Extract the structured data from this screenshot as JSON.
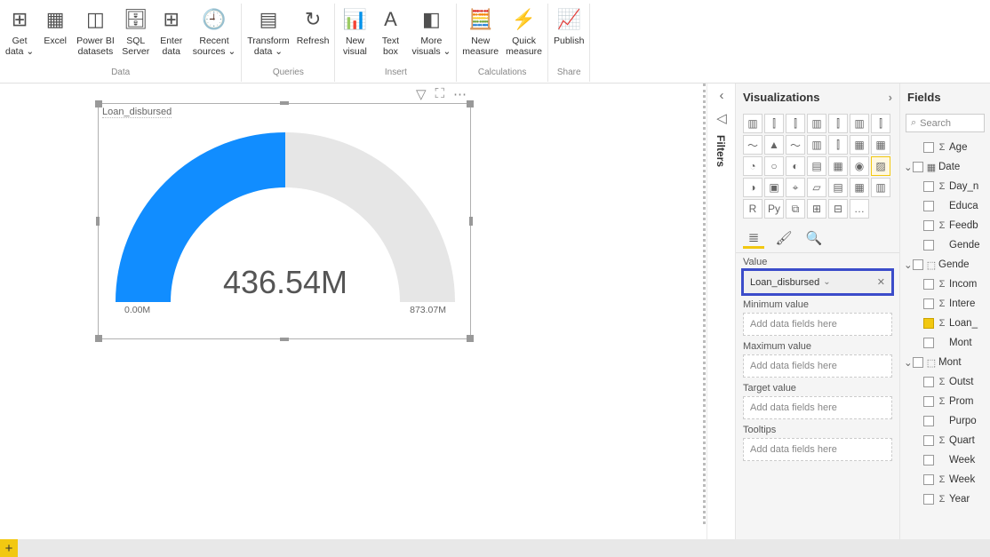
{
  "ribbon": {
    "groups": [
      {
        "label": "Data",
        "buttons": [
          {
            "label": "Get\ndata ⌄",
            "icon": "⊞"
          },
          {
            "label": "Excel",
            "icon": "▦"
          },
          {
            "label": "Power BI\ndatasets",
            "icon": "◫"
          },
          {
            "label": "SQL\nServer",
            "icon": "🗄"
          },
          {
            "label": "Enter\ndata",
            "icon": "⊞"
          },
          {
            "label": "Recent\nsources ⌄",
            "icon": "🕘"
          }
        ]
      },
      {
        "label": "Queries",
        "buttons": [
          {
            "label": "Transform\ndata ⌄",
            "icon": "▤"
          },
          {
            "label": "Refresh",
            "icon": "↻"
          }
        ]
      },
      {
        "label": "Insert",
        "buttons": [
          {
            "label": "New\nvisual",
            "icon": "📊"
          },
          {
            "label": "Text\nbox",
            "icon": "A"
          },
          {
            "label": "More\nvisuals ⌄",
            "icon": "◧"
          }
        ]
      },
      {
        "label": "Calculations",
        "buttons": [
          {
            "label": "New\nmeasure",
            "icon": "🧮"
          },
          {
            "label": "Quick\nmeasure",
            "icon": "⚡"
          }
        ]
      },
      {
        "label": "Share",
        "buttons": [
          {
            "label": "Publish",
            "icon": "📈"
          }
        ]
      }
    ]
  },
  "visual": {
    "title": "Loan_disbursed",
    "value_display": "436.54M",
    "min_label": "0.00M",
    "max_label": "873.07M",
    "actions": {
      "filter": "▽",
      "focus": "⛶",
      "more": "⋯"
    }
  },
  "collapsed": {
    "filters": "Filters",
    "arrow": "‹"
  },
  "viz": {
    "title": "Visualizations",
    "arrow": "›",
    "tabs": {
      "fields": "≣",
      "format": "🖌",
      "analytics": "🔍"
    },
    "wells": [
      {
        "label": "Value",
        "filled": true,
        "text": "Loan_disbursed",
        "highlight": true
      },
      {
        "label": "Minimum value",
        "filled": false,
        "text": "Add data fields here"
      },
      {
        "label": "Maximum value",
        "filled": false,
        "text": "Add data fields here"
      },
      {
        "label": "Target value",
        "filled": false,
        "text": "Add data fields here"
      },
      {
        "label": "Tooltips",
        "filled": false,
        "text": "Add data fields here"
      }
    ]
  },
  "fields": {
    "title": "Fields",
    "search": "Search",
    "items": [
      {
        "indent": 1,
        "check": false,
        "sig": "Σ",
        "name": "Age",
        "caret": ""
      },
      {
        "indent": 0,
        "check": false,
        "sig": "▦",
        "name": "Date",
        "caret": "⌄"
      },
      {
        "indent": 1,
        "check": false,
        "sig": "Σ",
        "name": "Day_n",
        "caret": ""
      },
      {
        "indent": 1,
        "check": false,
        "sig": "",
        "name": "Educa",
        "caret": ""
      },
      {
        "indent": 1,
        "check": false,
        "sig": "Σ",
        "name": "Feedb",
        "caret": ""
      },
      {
        "indent": 1,
        "check": false,
        "sig": "",
        "name": "Gende",
        "caret": ""
      },
      {
        "indent": 0,
        "check": false,
        "sig": "⬚",
        "name": "Gende",
        "caret": "⌄"
      },
      {
        "indent": 1,
        "check": false,
        "sig": "Σ",
        "name": "Incom",
        "caret": ""
      },
      {
        "indent": 1,
        "check": false,
        "sig": "Σ",
        "name": "Intere",
        "caret": ""
      },
      {
        "indent": 1,
        "check": true,
        "sig": "Σ",
        "name": "Loan_",
        "caret": ""
      },
      {
        "indent": 1,
        "check": false,
        "sig": "",
        "name": "Mont",
        "caret": ""
      },
      {
        "indent": 0,
        "check": false,
        "sig": "⬚",
        "name": "Mont",
        "caret": "⌄"
      },
      {
        "indent": 1,
        "check": false,
        "sig": "Σ",
        "name": "Outst",
        "caret": ""
      },
      {
        "indent": 1,
        "check": false,
        "sig": "Σ",
        "name": "Prom",
        "caret": ""
      },
      {
        "indent": 1,
        "check": false,
        "sig": "",
        "name": "Purpo",
        "caret": ""
      },
      {
        "indent": 1,
        "check": false,
        "sig": "Σ",
        "name": "Quart",
        "caret": ""
      },
      {
        "indent": 1,
        "check": false,
        "sig": "",
        "name": "Week",
        "caret": ""
      },
      {
        "indent": 1,
        "check": false,
        "sig": "Σ",
        "name": "Week",
        "caret": ""
      },
      {
        "indent": 1,
        "check": false,
        "sig": "Σ",
        "name": "Year",
        "caret": ""
      }
    ]
  },
  "chart_data": {
    "type": "gauge",
    "title": "Loan_disbursed",
    "min": 0.0,
    "max": 873.07,
    "value": 436.54,
    "unit": "M",
    "fill_color": "#118DFF",
    "empty_color": "#E6E6E6"
  }
}
